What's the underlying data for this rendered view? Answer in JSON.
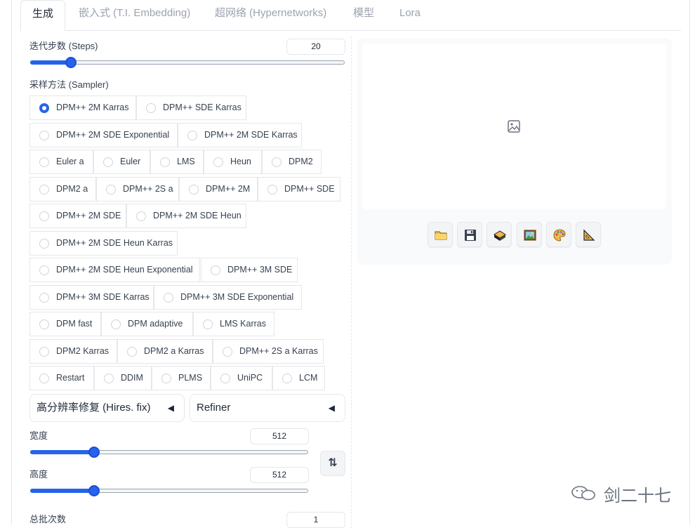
{
  "tabs": [
    "生成",
    "嵌入式 (T.I. Embedding)",
    "超网络 (Hypernetworks)",
    "模型",
    "Lora"
  ],
  "steps": {
    "label": "迭代步数 (Steps)",
    "value": "20",
    "fraction": 0.13
  },
  "sampler": {
    "label": "采样方法 (Sampler)",
    "selected": "DPM++ 2M Karras",
    "options": [
      "DPM++ 2M Karras",
      "DPM++ SDE Karras",
      "DPM++ 2M SDE Exponential",
      "DPM++ 2M SDE Karras",
      "Euler a",
      "Euler",
      "LMS",
      "Heun",
      "DPM2",
      "DPM2 a",
      "DPM++ 2S a",
      "DPM++ 2M",
      "DPM++ SDE",
      "DPM++ 2M SDE",
      "DPM++ 2M SDE Heun",
      "DPM++ 2M SDE Heun Karras",
      "DPM++ 2M SDE Heun Exponential",
      "DPM++ 3M SDE",
      "DPM++ 3M SDE Karras",
      "DPM++ 3M SDE Exponential",
      "DPM fast",
      "DPM adaptive",
      "LMS Karras",
      "DPM2 Karras",
      "DPM2 a Karras",
      "DPM++ 2S a Karras",
      "Restart",
      "DDIM",
      "PLMS",
      "UniPC",
      "LCM"
    ]
  },
  "hires": {
    "label": "高分辨率修复 (Hires. fix)",
    "arrow": "◀"
  },
  "refiner": {
    "label": "Refiner",
    "arrow": "◀"
  },
  "width": {
    "label": "宽度",
    "value": "512",
    "fraction": 0.23
  },
  "height": {
    "label": "高度",
    "value": "512",
    "fraction": 0.23
  },
  "batch_count": {
    "label": "总批次数",
    "value": "1"
  },
  "swap_icon": "⇅",
  "gallery": {
    "placeholder_icon": "image-icon",
    "tools": [
      "folder-icon",
      "save-icon",
      "zip-icon",
      "image-icon",
      "palette-icon",
      "ruler-icon"
    ]
  },
  "watermark": {
    "text": "剑二十七"
  }
}
